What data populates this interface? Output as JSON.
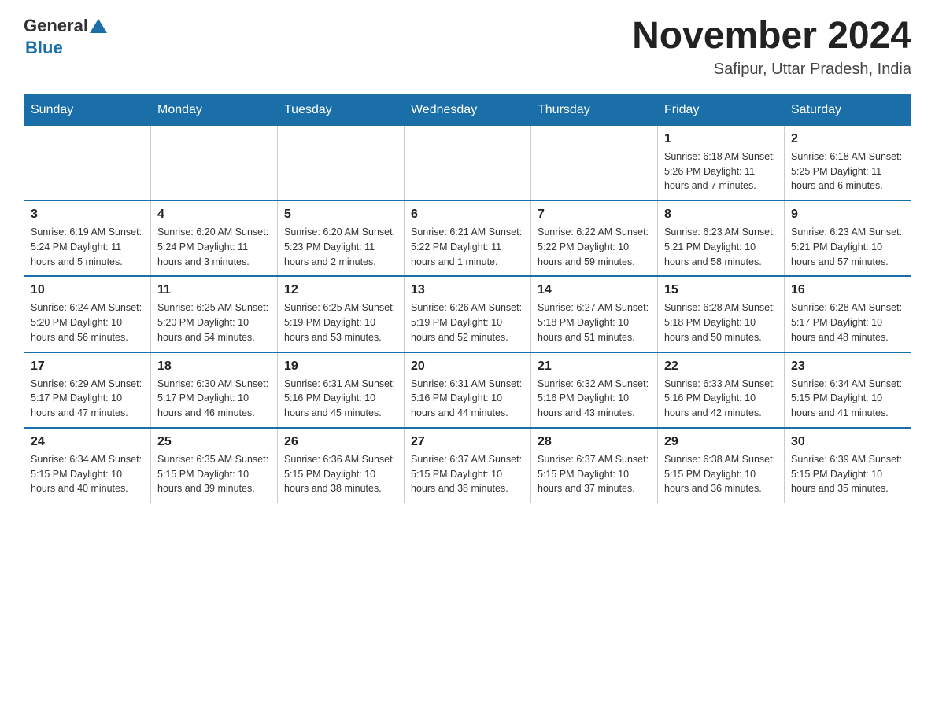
{
  "header": {
    "logo_general": "General",
    "logo_blue": "Blue",
    "month_year": "November 2024",
    "location": "Safipur, Uttar Pradesh, India"
  },
  "days_of_week": [
    "Sunday",
    "Monday",
    "Tuesday",
    "Wednesday",
    "Thursday",
    "Friday",
    "Saturday"
  ],
  "weeks": [
    [
      {
        "day": "",
        "info": ""
      },
      {
        "day": "",
        "info": ""
      },
      {
        "day": "",
        "info": ""
      },
      {
        "day": "",
        "info": ""
      },
      {
        "day": "",
        "info": ""
      },
      {
        "day": "1",
        "info": "Sunrise: 6:18 AM\nSunset: 5:26 PM\nDaylight: 11 hours and 7 minutes."
      },
      {
        "day": "2",
        "info": "Sunrise: 6:18 AM\nSunset: 5:25 PM\nDaylight: 11 hours and 6 minutes."
      }
    ],
    [
      {
        "day": "3",
        "info": "Sunrise: 6:19 AM\nSunset: 5:24 PM\nDaylight: 11 hours and 5 minutes."
      },
      {
        "day": "4",
        "info": "Sunrise: 6:20 AM\nSunset: 5:24 PM\nDaylight: 11 hours and 3 minutes."
      },
      {
        "day": "5",
        "info": "Sunrise: 6:20 AM\nSunset: 5:23 PM\nDaylight: 11 hours and 2 minutes."
      },
      {
        "day": "6",
        "info": "Sunrise: 6:21 AM\nSunset: 5:22 PM\nDaylight: 11 hours and 1 minute."
      },
      {
        "day": "7",
        "info": "Sunrise: 6:22 AM\nSunset: 5:22 PM\nDaylight: 10 hours and 59 minutes."
      },
      {
        "day": "8",
        "info": "Sunrise: 6:23 AM\nSunset: 5:21 PM\nDaylight: 10 hours and 58 minutes."
      },
      {
        "day": "9",
        "info": "Sunrise: 6:23 AM\nSunset: 5:21 PM\nDaylight: 10 hours and 57 minutes."
      }
    ],
    [
      {
        "day": "10",
        "info": "Sunrise: 6:24 AM\nSunset: 5:20 PM\nDaylight: 10 hours and 56 minutes."
      },
      {
        "day": "11",
        "info": "Sunrise: 6:25 AM\nSunset: 5:20 PM\nDaylight: 10 hours and 54 minutes."
      },
      {
        "day": "12",
        "info": "Sunrise: 6:25 AM\nSunset: 5:19 PM\nDaylight: 10 hours and 53 minutes."
      },
      {
        "day": "13",
        "info": "Sunrise: 6:26 AM\nSunset: 5:19 PM\nDaylight: 10 hours and 52 minutes."
      },
      {
        "day": "14",
        "info": "Sunrise: 6:27 AM\nSunset: 5:18 PM\nDaylight: 10 hours and 51 minutes."
      },
      {
        "day": "15",
        "info": "Sunrise: 6:28 AM\nSunset: 5:18 PM\nDaylight: 10 hours and 50 minutes."
      },
      {
        "day": "16",
        "info": "Sunrise: 6:28 AM\nSunset: 5:17 PM\nDaylight: 10 hours and 48 minutes."
      }
    ],
    [
      {
        "day": "17",
        "info": "Sunrise: 6:29 AM\nSunset: 5:17 PM\nDaylight: 10 hours and 47 minutes."
      },
      {
        "day": "18",
        "info": "Sunrise: 6:30 AM\nSunset: 5:17 PM\nDaylight: 10 hours and 46 minutes."
      },
      {
        "day": "19",
        "info": "Sunrise: 6:31 AM\nSunset: 5:16 PM\nDaylight: 10 hours and 45 minutes."
      },
      {
        "day": "20",
        "info": "Sunrise: 6:31 AM\nSunset: 5:16 PM\nDaylight: 10 hours and 44 minutes."
      },
      {
        "day": "21",
        "info": "Sunrise: 6:32 AM\nSunset: 5:16 PM\nDaylight: 10 hours and 43 minutes."
      },
      {
        "day": "22",
        "info": "Sunrise: 6:33 AM\nSunset: 5:16 PM\nDaylight: 10 hours and 42 minutes."
      },
      {
        "day": "23",
        "info": "Sunrise: 6:34 AM\nSunset: 5:15 PM\nDaylight: 10 hours and 41 minutes."
      }
    ],
    [
      {
        "day": "24",
        "info": "Sunrise: 6:34 AM\nSunset: 5:15 PM\nDaylight: 10 hours and 40 minutes."
      },
      {
        "day": "25",
        "info": "Sunrise: 6:35 AM\nSunset: 5:15 PM\nDaylight: 10 hours and 39 minutes."
      },
      {
        "day": "26",
        "info": "Sunrise: 6:36 AM\nSunset: 5:15 PM\nDaylight: 10 hours and 38 minutes."
      },
      {
        "day": "27",
        "info": "Sunrise: 6:37 AM\nSunset: 5:15 PM\nDaylight: 10 hours and 38 minutes."
      },
      {
        "day": "28",
        "info": "Sunrise: 6:37 AM\nSunset: 5:15 PM\nDaylight: 10 hours and 37 minutes."
      },
      {
        "day": "29",
        "info": "Sunrise: 6:38 AM\nSunset: 5:15 PM\nDaylight: 10 hours and 36 minutes."
      },
      {
        "day": "30",
        "info": "Sunrise: 6:39 AM\nSunset: 5:15 PM\nDaylight: 10 hours and 35 minutes."
      }
    ]
  ]
}
